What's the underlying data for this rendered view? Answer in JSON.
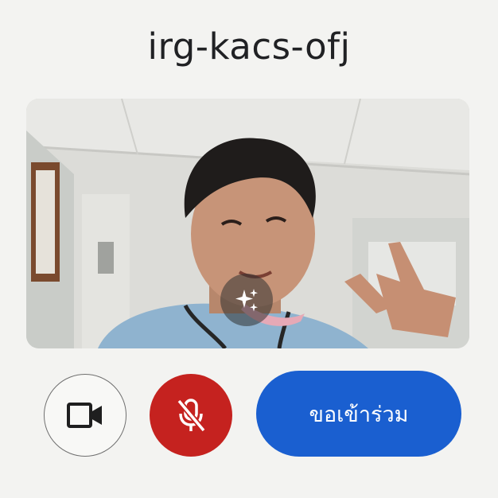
{
  "meeting": {
    "code": "irg-kacs-ofj"
  },
  "preview": {
    "effects_icon": "sparkle-icon"
  },
  "controls": {
    "camera_icon": "videocam-icon",
    "mic_icon": "mic-off-icon",
    "mic_state_color": "#c5221f",
    "join_label": "ขอเข้าร่วม",
    "join_color": "#1a5fd0"
  }
}
